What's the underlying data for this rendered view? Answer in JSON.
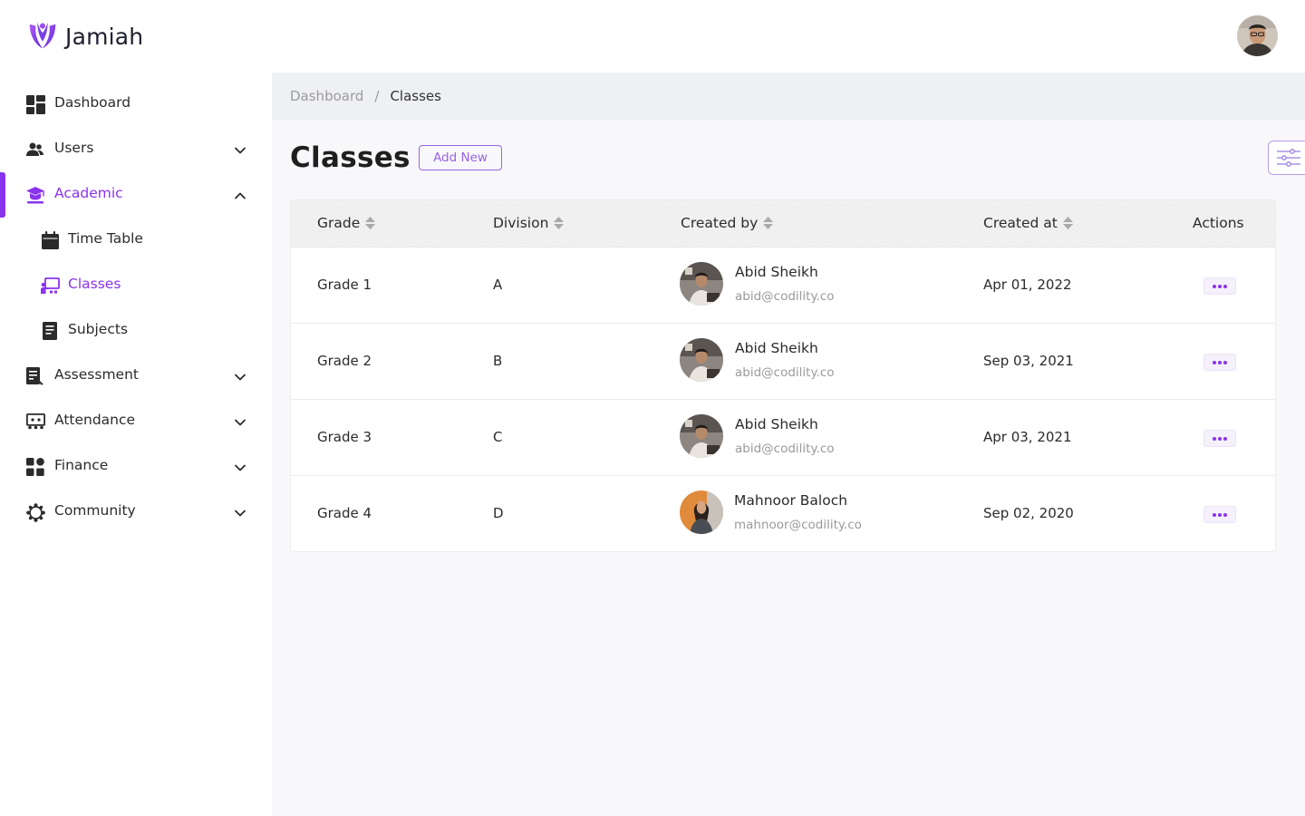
{
  "app": {
    "name": "Jamiah"
  },
  "colors": {
    "accent": "#8a33ec",
    "muted": "#9a9a9a"
  },
  "sidebar": {
    "items": [
      {
        "label": "Dashboard",
        "icon": "dashboard-icon"
      },
      {
        "label": "Users",
        "icon": "users-icon"
      },
      {
        "label": "Academic",
        "icon": "graduation-cap-icon"
      },
      {
        "label": "Time Table",
        "icon": "calendar-icon"
      },
      {
        "label": "Classes",
        "icon": "classroom-icon"
      },
      {
        "label": "Subjects",
        "icon": "book-icon"
      },
      {
        "label": "Assessment",
        "icon": "assessment-icon"
      },
      {
        "label": "Attendance",
        "icon": "attendance-icon"
      },
      {
        "label": "Finance",
        "icon": "finance-icon"
      },
      {
        "label": "Community",
        "icon": "community-icon"
      }
    ]
  },
  "breadcrumb": {
    "parent": "Dashboard",
    "separator": "/",
    "current": "Classes"
  },
  "page": {
    "title": "Classes",
    "add_new_label": "Add New"
  },
  "table": {
    "headers": {
      "grade": "Grade",
      "division": "Division",
      "created_by": "Created by",
      "created_at": "Created at",
      "actions": "Actions"
    },
    "rows": [
      {
        "grade": "Grade 1",
        "division": "A",
        "name": "Abid Sheikh",
        "email": "abid@codility.co",
        "date": "Apr 01, 2022"
      },
      {
        "grade": "Grade 2",
        "division": "B",
        "name": "Abid Sheikh",
        "email": "abid@codility.co",
        "date": "Sep 03, 2021"
      },
      {
        "grade": "Grade 3",
        "division": "C",
        "name": "Abid Sheikh",
        "email": "abid@codility.co",
        "date": "Apr 03, 2021"
      },
      {
        "grade": "Grade 4",
        "division": "D",
        "name": "Mahnoor Baloch",
        "email": "mahnoor@codility.co",
        "date": "Sep 02, 2020"
      }
    ]
  }
}
